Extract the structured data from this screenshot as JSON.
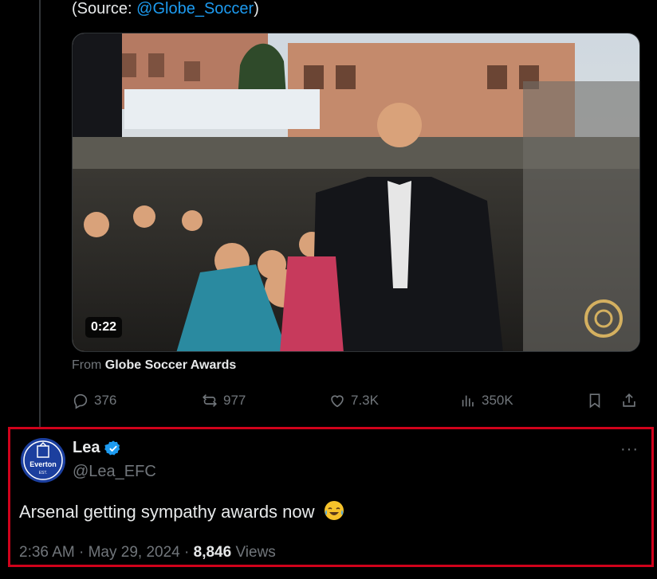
{
  "source": {
    "prefix": "(Source: ",
    "handle": "@Globe_Soccer",
    "suffix": ")"
  },
  "media": {
    "duration": "0:22"
  },
  "attribution": {
    "prefix": "From",
    "channel": "Globe Soccer Awards"
  },
  "actions": {
    "replies": "376",
    "reposts": "977",
    "likes": "7.3K",
    "views": "350K"
  },
  "reply_tweet": {
    "name": "Lea",
    "handle": "@Lea_EFC",
    "text": "Arsenal getting sympathy awards now",
    "time": "2:36 AM",
    "separator": "·",
    "date": "May 29, 2024",
    "view_count": "8,846",
    "views_label": "Views",
    "more": "···"
  },
  "avatar": {
    "top_text": "Everton",
    "sub_text": "EST."
  },
  "colors": {
    "background": "#000000",
    "text": "#e7e9ea",
    "muted": "#71767b",
    "link": "#1d9bf0",
    "highlight_border": "#d0021b"
  }
}
